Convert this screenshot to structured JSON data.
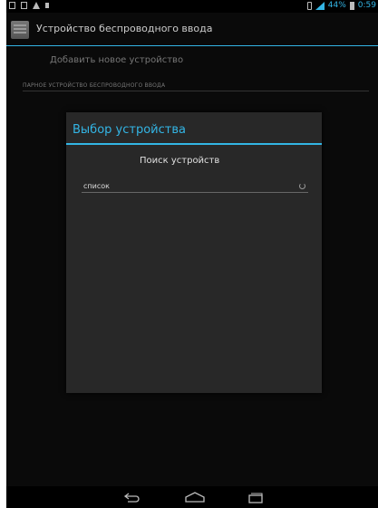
{
  "status_bar": {
    "battery_percent": "44%",
    "time": "0:59",
    "accent_color": "#33b5e5"
  },
  "action_bar": {
    "icon": "keyboard-icon",
    "title": "Устройство беспроводного ввода"
  },
  "main": {
    "add_device_label": "Добавить новое устройство",
    "paired_section_header": "ПАРНОЕ УСТРОЙСТВО БЕСПРОВОДНОГО ВВОДА"
  },
  "dialog": {
    "title": "Выбор устройства",
    "search_label": "Поиск устройств",
    "list_label": "список"
  },
  "nav_bar": {
    "icons": [
      "back-icon",
      "home-icon",
      "recent-apps-icon"
    ]
  }
}
